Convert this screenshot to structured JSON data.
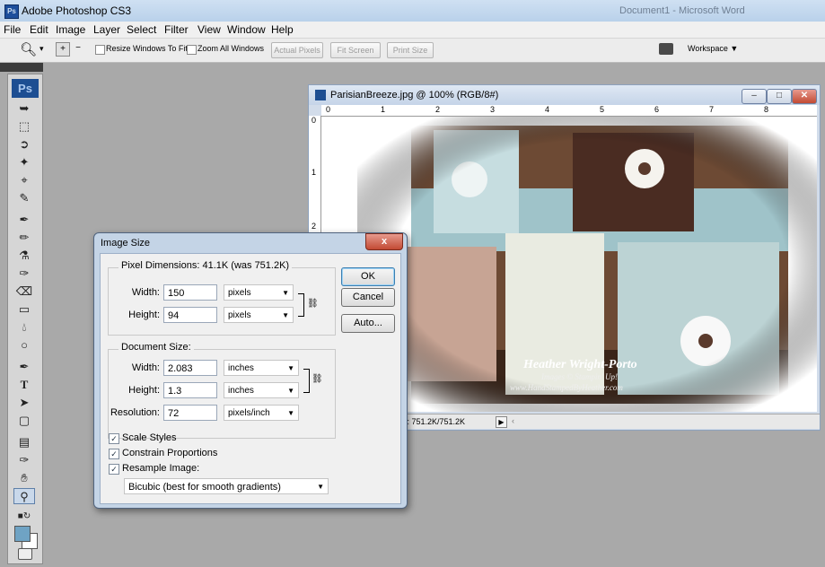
{
  "app": {
    "icon_label": "Ps",
    "title": "Adobe Photoshop CS3",
    "ext_title": "Document1 - Microsoft Word"
  },
  "menu": [
    "File",
    "Edit",
    "Image",
    "Layer",
    "Select",
    "Filter",
    "View",
    "Window",
    "Help"
  ],
  "options_bar": {
    "resize_windows_label": "Resize Windows To Fit",
    "zoom_all_label": "Zoom All Windows",
    "actual_pixels": "Actual Pixels",
    "fit_screen": "Fit Screen",
    "print_size": "Print Size",
    "workspace": "Workspace ▼"
  },
  "tools": {
    "logo": "Ps"
  },
  "document": {
    "title": "ParisianBreeze.jpg @ 100% (RGB/8#)",
    "ruler_top": [
      "0",
      "1",
      "2",
      "3",
      "4",
      "5",
      "6",
      "7",
      "8"
    ],
    "ruler_left": [
      "0",
      "1",
      "2"
    ],
    "status": "c: 751.2K/751.2K",
    "canvas_caption": "Heather Wright-Porto",
    "canvas_caption2": "Images © Stampin' Up!",
    "canvas_caption3": "www.HandStampedByHeather.com"
  },
  "dialog": {
    "title": "Image Size",
    "close": "x",
    "pixel_dimensions_label": "Pixel Dimensions:",
    "pixel_dimensions_value": "41.1K (was 751.2K)",
    "width_label": "Width:",
    "width_px": "150",
    "width_px_unit": "pixels",
    "height_label": "Height:",
    "height_px": "94",
    "height_px_unit": "pixels",
    "document_size_label": "Document Size:",
    "doc_width_label": "Width:",
    "doc_width": "2.083",
    "doc_width_unit": "inches",
    "doc_height_label": "Height:",
    "doc_height": "1.3",
    "doc_height_unit": "inches",
    "resolution_label": "Resolution:",
    "resolution": "72",
    "resolution_unit": "pixels/inch",
    "scale_styles": "Scale Styles",
    "constrain_proportions": "Constrain Proportions",
    "resample_image": "Resample Image:",
    "resample_method": "Bicubic (best for smooth gradients)",
    "ok": "OK",
    "cancel": "Cancel",
    "auto": "Auto..."
  }
}
